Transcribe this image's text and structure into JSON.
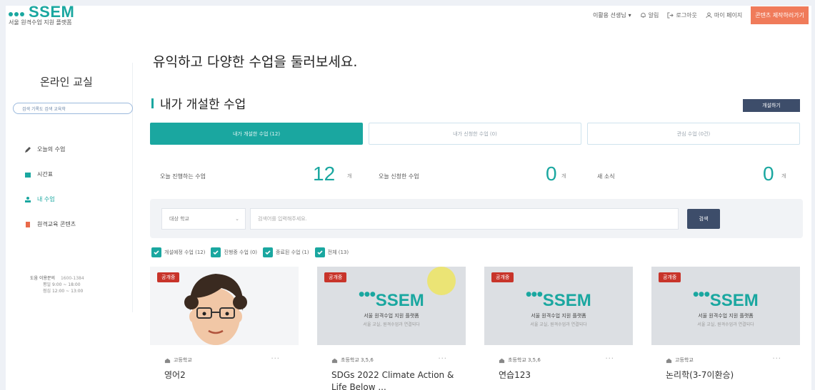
{
  "header": {
    "logo_text": "SSEM",
    "logo_subtitle": "서울 원격수업 지원 플랫폼",
    "user_name": "이활용 선생님",
    "nav": [
      {
        "label": "알림",
        "icon": "bell-icon"
      },
      {
        "label": "로그아웃",
        "icon": "logout-icon"
      },
      {
        "label": "마이 페이지",
        "icon": "user-icon"
      }
    ],
    "cta_label": "콘텐츠 제작하러가기"
  },
  "sidebar": {
    "title": "온라인 교실",
    "pill_text": "검색 기록도 검색 교육학",
    "items": [
      {
        "label": "오늘의 수업",
        "icon": "pencil-icon",
        "active": false
      },
      {
        "label": "시간표",
        "icon": "calendar-icon",
        "active": false
      },
      {
        "label": "내 수업",
        "icon": "person-icon",
        "active": true
      },
      {
        "label": "원격교육 콘텐츠",
        "icon": "content-icon",
        "active": false
      }
    ],
    "info_title": "도움 이용문의",
    "info_phone": "1600-1384",
    "info_hours_1": "평일 9:00 ~ 18:00",
    "info_hours_2": "점심 12:00 ~ 13:00"
  },
  "main": {
    "title": "유익하고 다양한 수업을 둘러보세요.",
    "section_title": "내가 개설한 수업",
    "create_button": "개설하기",
    "tabs": [
      {
        "label": "내가 개설한 수업 (12)",
        "active": true
      },
      {
        "label": "내가 신청한 수업 (0)",
        "active": false
      },
      {
        "label": "관심 수업 (0건)",
        "active": false
      }
    ],
    "stats": [
      {
        "label": "오늘 진행하는 수업",
        "value": "12",
        "unit": "개"
      },
      {
        "label": "오늘 신청한 수업",
        "value": "0",
        "unit": "개"
      },
      {
        "label": "새 소식",
        "value": "0",
        "unit": "개"
      }
    ],
    "search": {
      "select_value": "대상 학교",
      "placeholder": "검색어를 입력해주세요.",
      "button": "검색"
    },
    "filters": [
      {
        "label": "개설예정 수업 (12)"
      },
      {
        "label": "진행중 수업 (0)"
      },
      {
        "label": "종료된 수업 (1)"
      },
      {
        "label": "전체 (13)"
      }
    ],
    "cards": [
      {
        "badge": "공개중",
        "school": "고등학교",
        "title": "영어2",
        "thumb": "avatar"
      },
      {
        "badge": "공개중",
        "school": "초등학교 3,5,6",
        "title": "SDGs 2022 Climate Action & Life Below ...",
        "thumb": "logo"
      },
      {
        "badge": "공개중",
        "school": "초등학교 3,5,6",
        "title": "연습123",
        "thumb": "logo"
      },
      {
        "badge": "공개중",
        "school": "고등학교",
        "title": "논리학(3-7이환승)",
        "thumb": "logo"
      }
    ],
    "thumb_logo_text": "SSEM",
    "thumb_logo_sub": "서울 원격수업 지원 플랫폼",
    "thumb_logo_sub2": "서울 교실, 원격수업과 연결되다"
  },
  "colors": {
    "accent": "#1aa7a0",
    "cta": "#f07b5a",
    "dark_button": "#3d4d6a",
    "badge": "#c8342a"
  }
}
